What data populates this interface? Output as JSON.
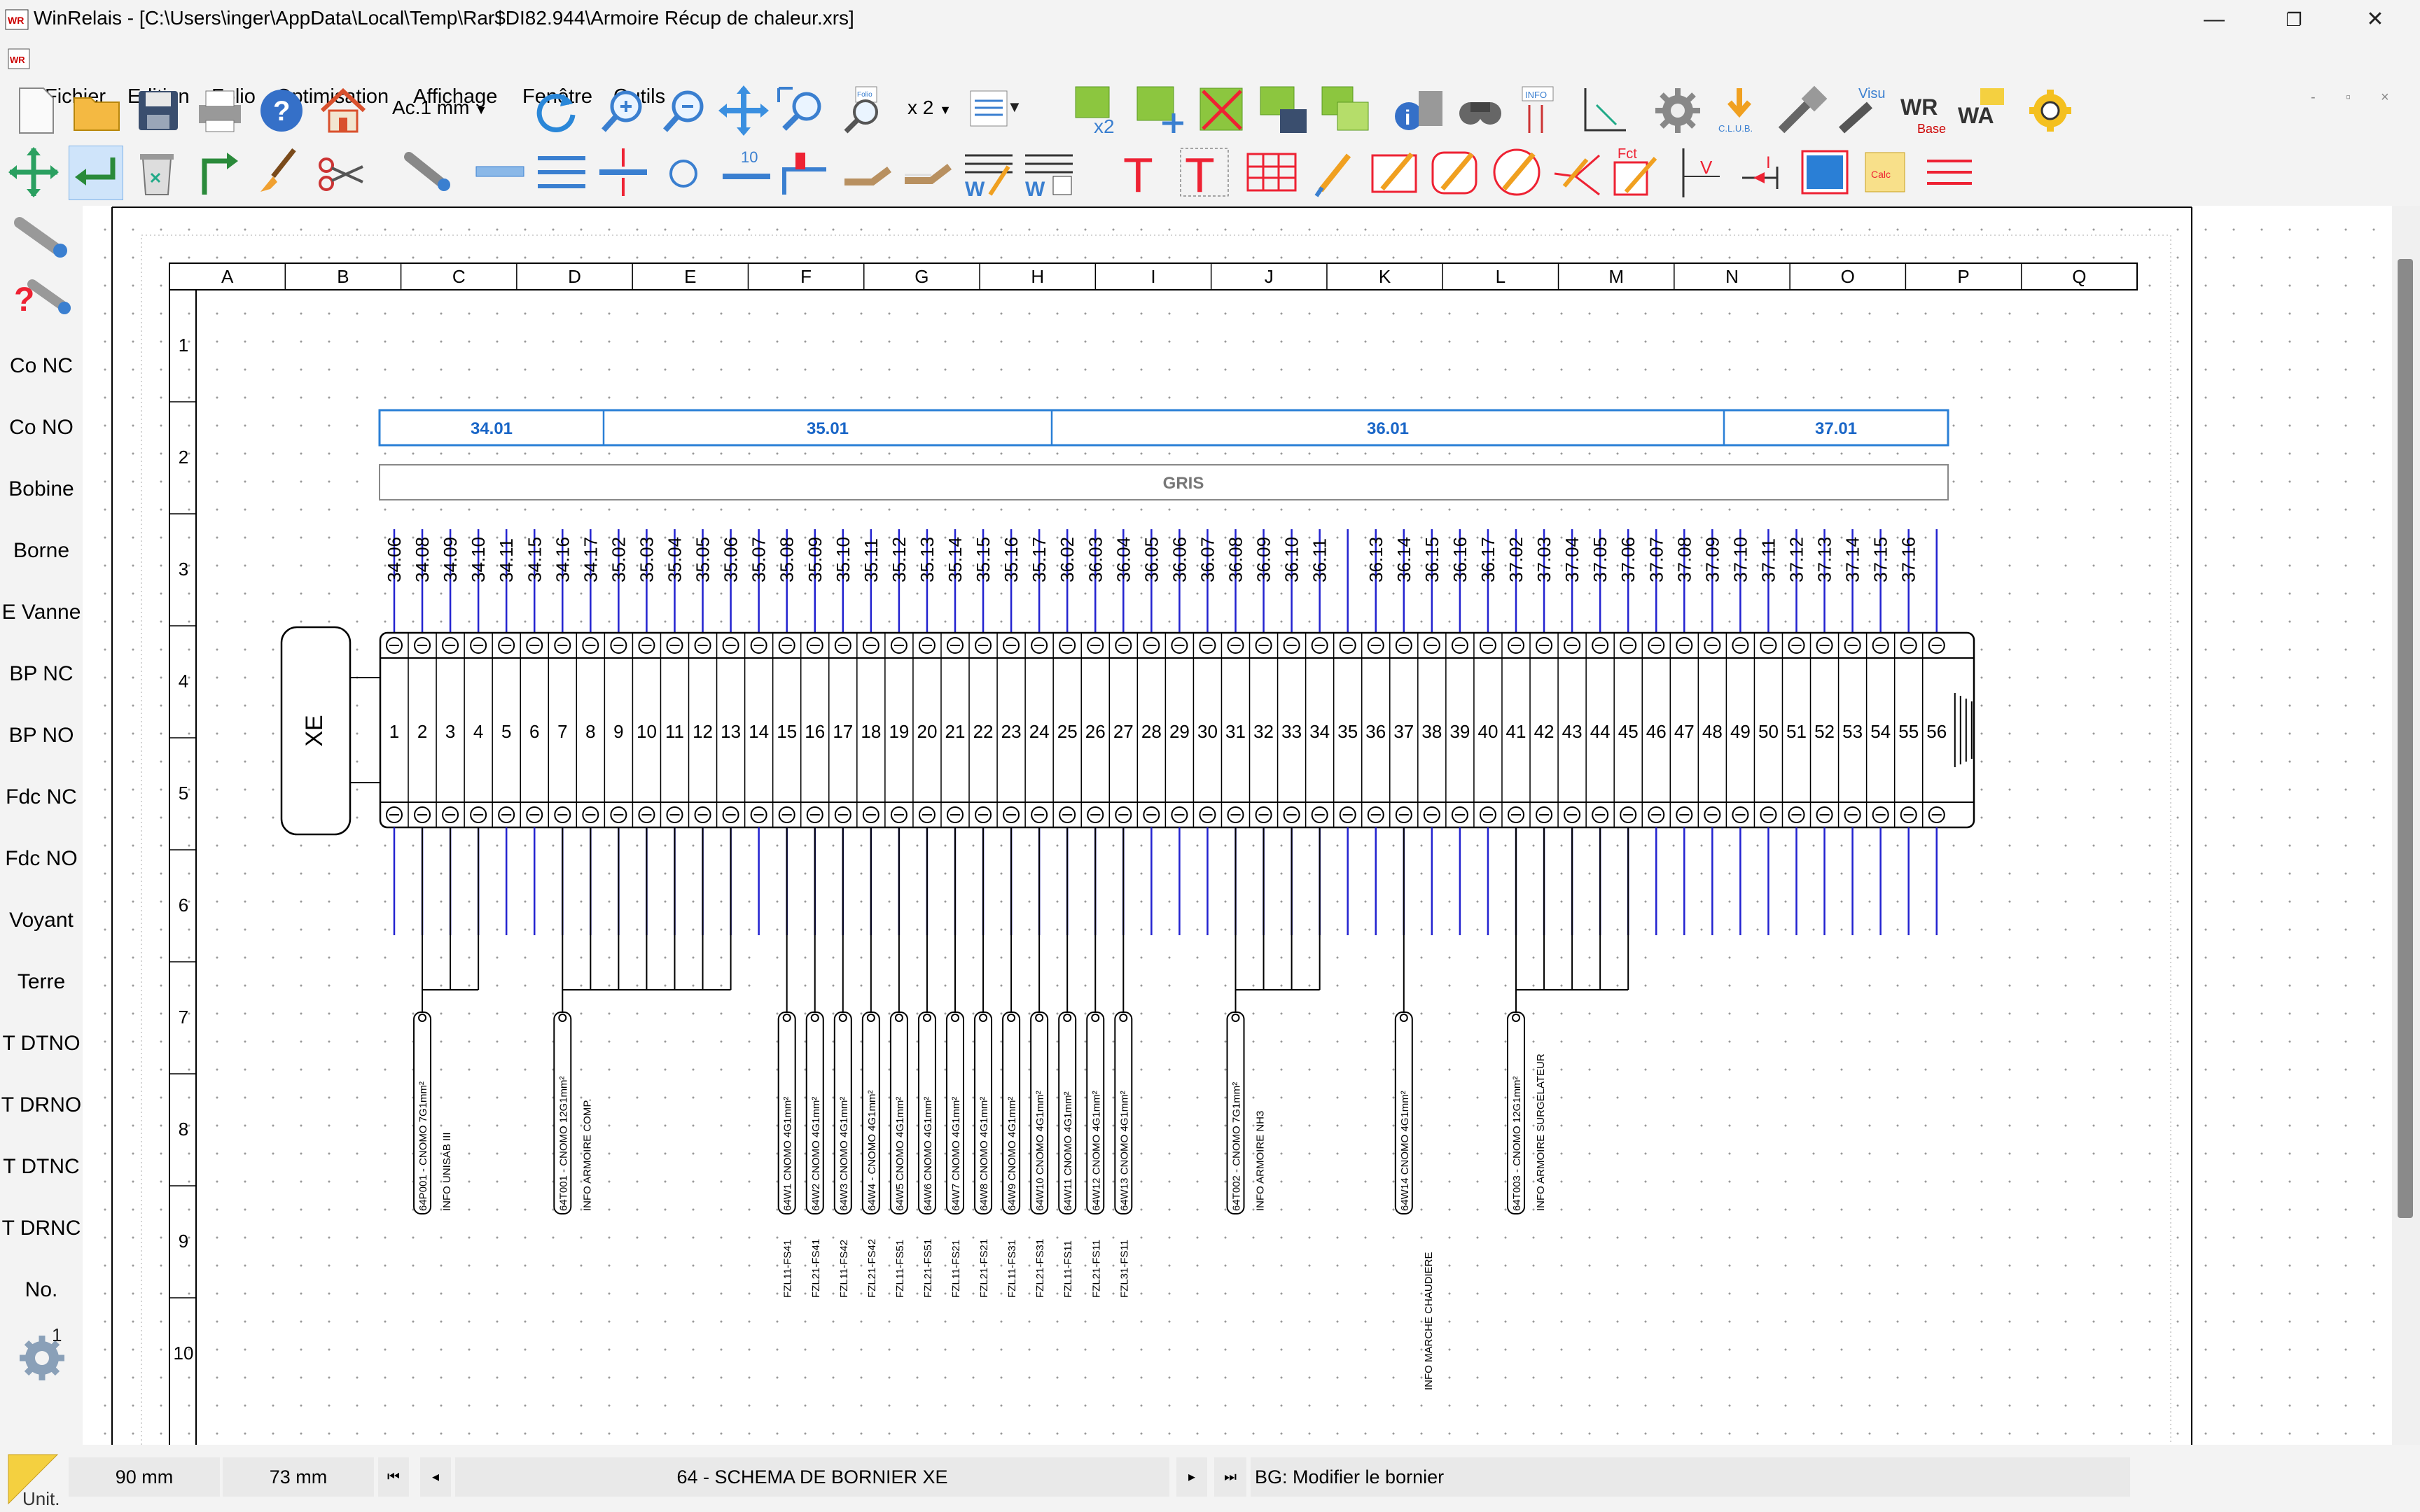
{
  "window": {
    "title": "WinRelais - [C:\\Users\\inger\\AppData\\Local\\Temp\\Rar$DI82.944\\Armoire Récup de chaleur.xrs]",
    "minimize": "—",
    "restore": "❐",
    "close": "✕"
  },
  "menu": [
    "Fichier",
    "Edition",
    "Folio",
    "Optimisation",
    "Affichage",
    "Fenêtre",
    "Outils"
  ],
  "mdi_controls": [
    "-",
    "▫",
    "×"
  ],
  "toolbar1": {
    "scale_value": "Ac.1 mm",
    "zoom_factor": "x 2",
    "icons": [
      "new-icon",
      "open-icon",
      "save-icon",
      "print-icon",
      "help-icon",
      "home-icon",
      "redo-icon",
      "zoom-in-icon",
      "zoom-out-icon",
      "pan-icon",
      "zoom-window-icon",
      "zoom-page-icon",
      "folio-list-icon",
      "duplicate-x2-icon",
      "move-icon",
      "delete-icon",
      "folio-save-icon",
      "folio-copy-icon",
      "info-icon",
      "search-icon",
      "info-list-icon",
      "coordinates-icon",
      "settings-icon",
      "download-icon",
      "tool-icon",
      "visu-icon",
      "wr-base-icon",
      "wa-icon",
      "gear-yellow-icon"
    ],
    "labels": {
      "club": "C.L.U.B.",
      "info": "INFO",
      "visu": "Visu",
      "wr": "WR",
      "base": "Base",
      "wa": "WA",
      "x2": "x2",
      "fct": "Fct",
      "folio": "Folio"
    }
  },
  "toolbar2": {
    "icons": [
      "move-cross-icon",
      "enter-icon",
      "trash-icon",
      "arrow-corner-icon",
      "brush-icon",
      "scissors-icon",
      "component-icon",
      "line-icon",
      "multi-line-icon",
      "split-line-icon",
      "circle-icon",
      "bus-10-icon",
      "connector-icon",
      "cable-icon",
      "cable2-icon",
      "word-w1-icon",
      "word-w2-icon",
      "text-t-icon",
      "text-t-box-icon",
      "table-icon",
      "pen-icon",
      "pen-rect-icon",
      "pen-round-icon",
      "pen-circle-icon",
      "pen-fork-icon",
      "fct-icon",
      "v-marker-icon",
      "i-marker-icon",
      "image-icon",
      "note-icon",
      "triple-line-icon"
    ],
    "bus_number": "10",
    "i_label": "I",
    "v_label": "V"
  },
  "left_panel": [
    "Co NC",
    "Co NO",
    "Bobine",
    "Borne",
    "E Vanne",
    "BP NC",
    "BP NO",
    "Fdc NC",
    "Fdc NO",
    "Voyant",
    "Terre",
    "T DTNO",
    "T DRNO",
    "T DTNC",
    "T DRNC",
    "No."
  ],
  "left_panel_settings_badge": "1",
  "drawing": {
    "columns": [
      "A",
      "B",
      "C",
      "D",
      "E",
      "F",
      "G",
      "H",
      "I",
      "J",
      "K",
      "L",
      "M",
      "N",
      "O",
      "P",
      "Q"
    ],
    "rows": [
      "1",
      "2",
      "3",
      "4",
      "5",
      "6",
      "7",
      "8",
      "9",
      "10"
    ],
    "groups": [
      "34.01",
      "35.01",
      "36.01",
      "37.01"
    ],
    "wire_color": "GRIS",
    "strip_name": "XE",
    "top_labels": [
      "34.06",
      "34.08",
      "34.09",
      "34.10",
      "34.11",
      "34.15",
      "34.16",
      "34.17",
      "35.02",
      "35.03",
      "35.04",
      "35.05",
      "35.06",
      "35.07",
      "35.08",
      "35.09",
      "35.10",
      "35.11",
      "35.12",
      "35.13",
      "35.14",
      "35.15",
      "35.16",
      "35.17",
      "36.02",
      "36.03",
      "36.04",
      "36.05",
      "36.06",
      "36.07",
      "36.08",
      "36.09",
      "36.10",
      "36.11",
      "",
      "36.13",
      "36.14",
      "36.15",
      "36.16",
      "36.17",
      "37.02",
      "37.03",
      "37.04",
      "37.05",
      "37.06",
      "37.07",
      "37.08",
      "37.09",
      "37.10",
      "37.11",
      "37.12",
      "37.13",
      "37.14",
      "37.15",
      "37.16",
      ""
    ],
    "terminals": [
      "1",
      "2",
      "3",
      "4",
      "5",
      "6",
      "7",
      "8",
      "9",
      "10",
      "11",
      "12",
      "13",
      "14",
      "15",
      "16",
      "17",
      "18",
      "19",
      "20",
      "21",
      "22",
      "23",
      "24",
      "25",
      "26",
      "27",
      "28",
      "29",
      "30",
      "31",
      "32",
      "33",
      "34",
      "35",
      "36",
      "37",
      "38",
      "39",
      "40",
      "41",
      "42",
      "43",
      "44",
      "45",
      "46",
      "47",
      "48",
      "49",
      "50",
      "51",
      "52",
      "53",
      "54",
      "55",
      "56"
    ],
    "cables": [
      {
        "terminal": 2,
        "cable": "64P001 - CNOMO 7G1mm²",
        "info": "INFO UNISAB III"
      },
      {
        "terminal": 7,
        "cable": "64T001 - CNOMO 12G1mm²",
        "info": "INFO ARMOIRE COMP."
      },
      {
        "terminal": 15,
        "cable": "64W1 CNOMO 4G1mm²",
        "info": "FZL11-FS41"
      },
      {
        "terminal": 16,
        "cable": "64W2 CNOMO 4G1mm²",
        "info": "FZL21-FS41"
      },
      {
        "terminal": 17,
        "cable": "64W3 CNOMO 4G1mm²",
        "info": "FZL11-FS42"
      },
      {
        "terminal": 18,
        "cable": "64W4 - CNOMO 4G1mm²",
        "info": "FZL21-FS42"
      },
      {
        "terminal": 19,
        "cable": "64W5 CNOMO 4G1mm²",
        "info": "FZL11-FS51"
      },
      {
        "terminal": 20,
        "cable": "64W6 CNOMO 4G1mm²",
        "info": "FZL21-FS51"
      },
      {
        "terminal": 21,
        "cable": "64W7 CNOMO 4G1mm²",
        "info": "FZL11-FS21"
      },
      {
        "terminal": 22,
        "cable": "64W8 CNOMO 4G1mm²",
        "info": "FZL21-FS21"
      },
      {
        "terminal": 23,
        "cable": "64W9 CNOMO 4G1mm²",
        "info": "FZL11-FS31"
      },
      {
        "terminal": 24,
        "cable": "64W10 CNOMO 4G1mm²",
        "info": "FZL21-FS31"
      },
      {
        "terminal": 25,
        "cable": "64W11 CNOMO 4G1mm²",
        "info": "FZL11-FS11"
      },
      {
        "terminal": 26,
        "cable": "64W12 CNOMO 4G1mm²",
        "info": "FZL21-FS11"
      },
      {
        "terminal": 27,
        "cable": "64W13 CNOMO 4G1mm²",
        "info": "FZL31-FS11"
      },
      {
        "terminal": 31,
        "cable": "64T002 - CNOMO 7G1mm²",
        "info": "INFO ARMOIRE NH3"
      },
      {
        "terminal": 37,
        "cable": "64W14 CNOMO 4G1mm²",
        "info": "INFO MARCHE CHAUDIERE"
      },
      {
        "terminal": 41,
        "cable": "64T003 - CNOMO 12G1mm²",
        "info": "INFO ARMOIRE SURGELATEUR"
      }
    ]
  },
  "status": {
    "unit_label": "Unit.",
    "x_pos": "90 mm",
    "y_pos": "73 mm",
    "nav_first": "⏮",
    "nav_prev": "◂",
    "folio_name": "64 - SCHEMA DE BORNIER XE",
    "nav_next": "▸",
    "nav_last": "⏭",
    "message": "BG: Modifier le bornier"
  },
  "colors": {
    "blue_wire": "#2222d0",
    "group_box": "#2a7fd6",
    "group_text": "#1a66c7"
  }
}
